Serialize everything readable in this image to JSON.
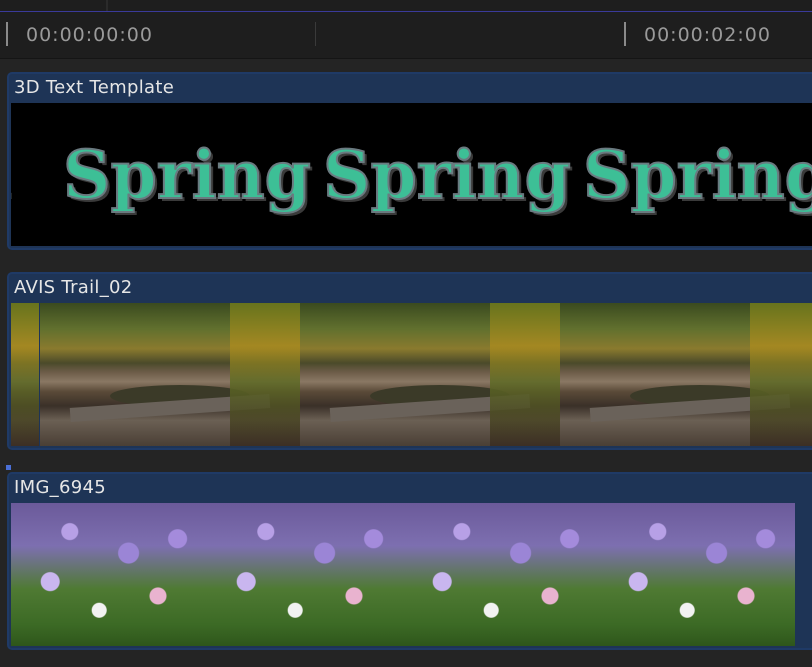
{
  "ruler": {
    "timecodes": [
      "00:00:00:00",
      "00:00:02:00"
    ]
  },
  "clips": [
    {
      "label": "3D Text Template",
      "type": "title",
      "title_text": "Spring",
      "text_color": "#3dbf96"
    },
    {
      "label": "AVIS Trail_02",
      "type": "video"
    },
    {
      "label": "IMG_6945",
      "type": "image"
    }
  ],
  "colors": {
    "clip_bar": "#1e3456",
    "background": "#242424",
    "timecode_text": "#9a9a9a"
  }
}
